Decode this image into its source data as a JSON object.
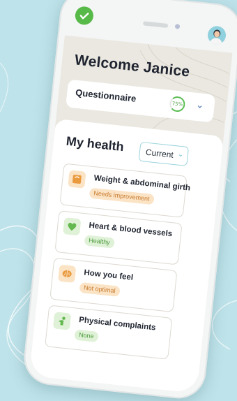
{
  "header": {
    "status_icon": "check-icon",
    "avatar_icon": "user-avatar"
  },
  "welcome": {
    "title": "Welcome Janice"
  },
  "questionnaire": {
    "label": "Questionnaire",
    "progress_text": "75%",
    "progress": 0.75,
    "expand_icon": "chevron-down-icon"
  },
  "my_health": {
    "title": "My health",
    "filter": {
      "selected": "Current",
      "icon": "chevron-down-icon"
    },
    "items": [
      {
        "title": "Weight & abdominal girth",
        "status": "Needs improvement",
        "status_color": "#c77a2c",
        "icon": "scale-icon",
        "icon_color": "#e99a3f"
      },
      {
        "title": "Heart & blood vessels",
        "status": "Healthy",
        "status_color": "#4d9c3f",
        "icon": "heart-icon",
        "icon_color": "#63b84f"
      },
      {
        "title": "How you feel",
        "status": "Not optimal",
        "status_color": "#c77a2c",
        "icon": "brain-icon",
        "icon_color": "#e99a3f"
      },
      {
        "title": "Physical complaints",
        "status": "None",
        "status_color": "#4d9c3f",
        "icon": "body-icon",
        "icon_color": "#63b84f"
      }
    ]
  },
  "colors": {
    "accent_green": "#57b947",
    "accent_orange": "#e99a3f",
    "background": "#bfe3ea"
  }
}
